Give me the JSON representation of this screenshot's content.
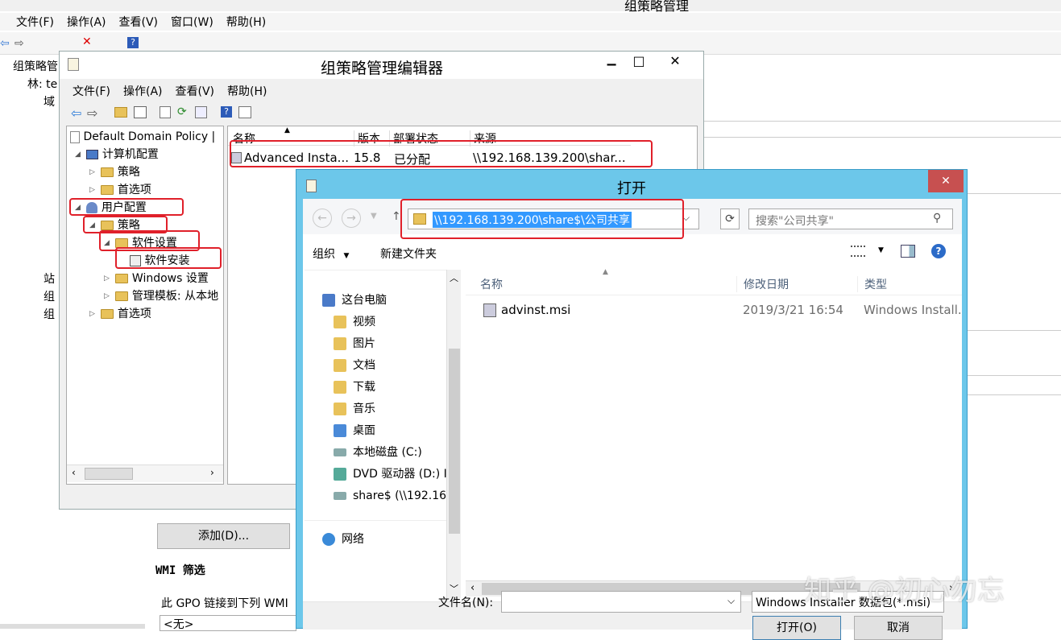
{
  "bg_app": {
    "title": "组策略管理",
    "menu": [
      "文件(F)",
      "操作(A)",
      "查看(V)",
      "窗口(W)",
      "帮助(H)"
    ],
    "tree": [
      "组策略管",
      "林: te",
      "域",
      "站",
      "组",
      "组"
    ],
    "add_button": "添加(D)...",
    "wmi_title": "WMI 筛选",
    "wmi_text": "此 GPO 链接到下列 WMI",
    "wmi_value": "<无>"
  },
  "editor": {
    "title": "组策略管理编辑器",
    "menu": [
      "文件(F)",
      "操作(A)",
      "查看(V)",
      "帮助(H)"
    ],
    "tree": {
      "root": "Default Domain Policy |",
      "computer": "计算机配置",
      "policy1": "策略",
      "pref1": "首选项",
      "user": "用户配置",
      "policy2": "策略",
      "software_settings": "软件设置",
      "software_install": "软件安装",
      "windows_settings": "Windows 设置",
      "admin_templates": "管理模板: 从本地",
      "pref2": "首选项"
    },
    "columns": [
      "名称",
      "版本",
      "部署状态",
      "来源"
    ],
    "row": {
      "name": "Advanced Insta...",
      "version": "15.8",
      "status": "已分配",
      "source": "\\\\192.168.139.200\\shar..."
    },
    "win_buttons": [
      "▁",
      "□",
      "✕"
    ]
  },
  "dialog": {
    "title": "打开",
    "close": "✕",
    "address": "\\\\192.168.139.200\\share$\\公司共享",
    "search_placeholder": "搜索\"公司共享\"",
    "organize": "组织",
    "new_folder": "新建文件夹",
    "nav": [
      "这台电脑",
      "视频",
      "图片",
      "文档",
      "下载",
      "音乐",
      "桌面",
      "本地磁盘 (C:)",
      "DVD 驱动器 (D:) I",
      "share$ (\\\\192.16",
      "网络"
    ],
    "columns": [
      "名称",
      "修改日期",
      "类型"
    ],
    "file": {
      "name": "advinst.msi",
      "date": "2019/3/21 16:54",
      "type": "Windows Install..."
    },
    "filename_label": "文件名(N):",
    "filename_value": "",
    "filter": "Windows Installer 数据包(*.msi)",
    "open_button": "打开(O)",
    "cancel_button": "取消"
  },
  "watermark": "知乎 @初心勿忘",
  "colors": {
    "accent_red": "#e0202a",
    "dialog_border": "#6cc7ea",
    "selection": "#3399ff"
  }
}
